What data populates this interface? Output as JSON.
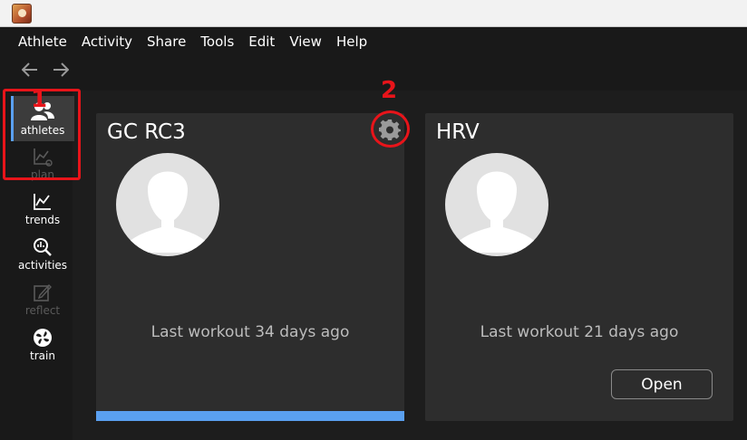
{
  "menu": {
    "items": [
      "Athlete",
      "Activity",
      "Share",
      "Tools",
      "Edit",
      "View",
      "Help"
    ]
  },
  "sidebar": {
    "items": [
      {
        "label": "athletes",
        "icon": "athletes-icon",
        "state": "active"
      },
      {
        "label": "plan",
        "icon": "plan-icon",
        "state": "disabled"
      },
      {
        "label": "trends",
        "icon": "trends-icon",
        "state": "enabled"
      },
      {
        "label": "activities",
        "icon": "activities-icon",
        "state": "enabled"
      },
      {
        "label": "reflect",
        "icon": "reflect-icon",
        "state": "disabled"
      },
      {
        "label": "train",
        "icon": "train-icon",
        "state": "enabled"
      }
    ]
  },
  "annotations": {
    "one": "1",
    "two": "2",
    "color": "#e8141a"
  },
  "cards": [
    {
      "name": "GC RC3",
      "last_workout": "Last workout 34 days ago",
      "progress_fraction": 1.0
    },
    {
      "name": "HRV",
      "last_workout": "Last workout 21 days ago",
      "button": "Open"
    }
  ],
  "colors": {
    "accent": "#5aa0f0",
    "background": "#191919",
    "card": "#2d2d2d"
  }
}
